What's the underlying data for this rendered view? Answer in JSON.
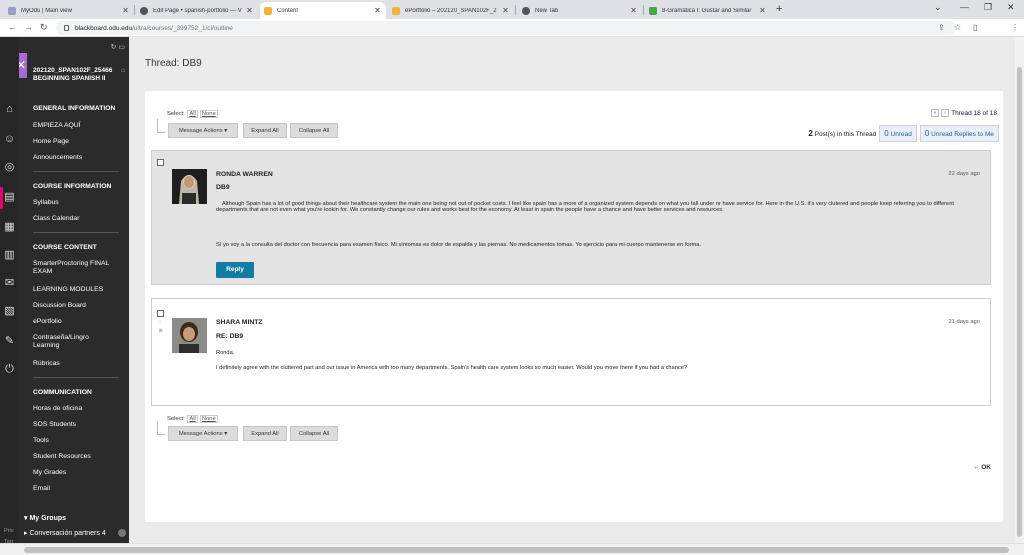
{
  "browser": {
    "tabs": [
      {
        "title": "MyOdu | Main view",
        "color": "#9aa0c7"
      },
      {
        "title": "Edit Page • spanish-portfolio — V",
        "color": "#555"
      },
      {
        "title": "Content",
        "color": "#f0b43c"
      },
      {
        "title": "ePortfolio – 202120_SPAN102F_2",
        "color": "#f0b43c"
      },
      {
        "title": "New Tab",
        "color": "#555"
      },
      {
        "title": "8-Gramática I: Gustar and Similar",
        "color": "#4ca34c"
      }
    ],
    "url_host": "blackboard.odu.edu",
    "url_path": "/ultra/courses/_399752_1/cl/outline"
  },
  "sidebar": {
    "course_title": "202120_SPAN102F_25466 BEGINNING SPANISH II",
    "sections": [
      {
        "title": "GENERAL INFORMATION",
        "items": [
          "EMPIEZA AQUÍ",
          "Home Page",
          "Announcements"
        ]
      },
      {
        "title": "COURSE INFORMATION",
        "items": [
          "Syllabus",
          "Class Calendar"
        ]
      },
      {
        "title": "COURSE CONTENT",
        "items": [
          "SmarterProctoring FINAL EXAM",
          "LEARNING MODULES",
          "Discussion Board",
          "ePortfolio",
          "Contraseña/Lingro Learning",
          "Rúbricas"
        ]
      },
      {
        "title": "COMMUNICATION",
        "items": [
          "Horas de oficina",
          "SOS Students",
          "Tools",
          "Student Resources",
          "My Grades",
          "Email"
        ]
      }
    ],
    "my_groups": "My Groups",
    "group_item": "Conversación partners 4"
  },
  "thread": {
    "title": "Thread: DB9",
    "select_label": "Select:",
    "select_all": "All",
    "select_none": "None",
    "message_actions": "Message Actions",
    "expand_all": "Expand All",
    "collapse_all": "Collapse All",
    "pager": "Thread 18 of 18",
    "posts_count": "2",
    "posts_label": "Post(s) in this Thread",
    "unread_count": "0",
    "unread_label": "Unread",
    "unread_replies_count": "0",
    "unread_replies_label": "Unread Replies to Me",
    "ok": "OK"
  },
  "posts": [
    {
      "author": "RONDA WARREN",
      "title": "DB9",
      "date": "22 days ago",
      "p1": "Although Spain has a lot of good things about their healthcare system the main one being not out of pocket costs. I feel like spain has a more of a organized system depends on what you fall under or have service for. Here in the U.S. it's very clutered and people keep referring you to different departments that are not even what you're lookin for. We constantly change our rules and works best for the economy. At least in spain the people have a chance and have better services and resources.",
      "p2": "Sí yo voy a la consulta del doctor con frecuencia para examen físico. Mi síntomas es dolor de espalda y las piernas. No medicamentos tomas. Yo ejercicio para mi cuerpo mantenerse en forma.",
      "reply": "Reply"
    },
    {
      "author": "SHARA MINTZ",
      "title": "RE: DB9",
      "date": "21 days ago",
      "p1": "Ronda,",
      "p2": "I definitely agree with the cluttered part and our issue in America with too many departments. Spain's health care system looks so much easier. Would you move there if you had a chance?"
    }
  ],
  "footer": {
    "line1": "Priv",
    "line2": "Terr"
  }
}
